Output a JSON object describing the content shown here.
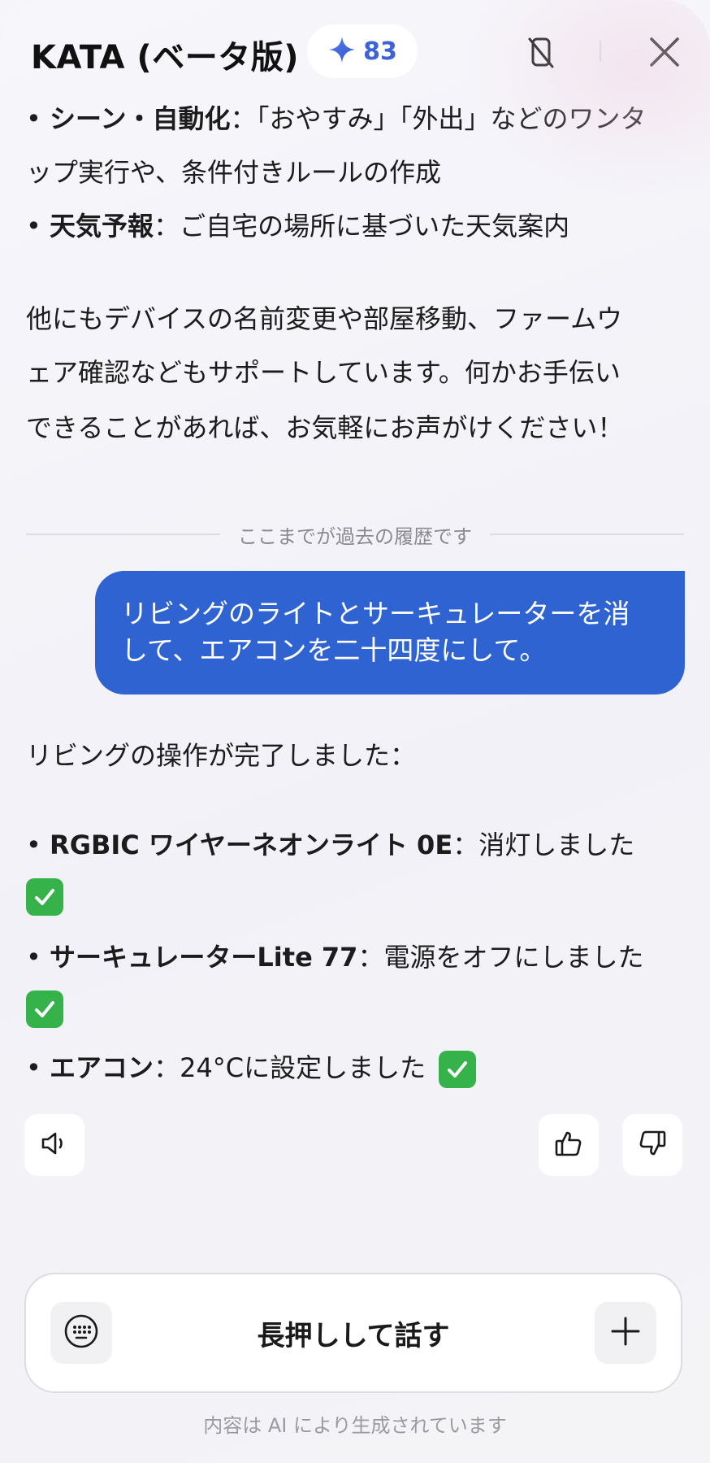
{
  "header": {
    "title": "KATA (ベータ版)",
    "credits": "83",
    "accent": "#3e63d6"
  },
  "prev_message": {
    "bullet1_title": "シーン・自動化",
    "bullet1_text_a": "「おやすみ」「外出」などのワンタ",
    "bullet1_text_b": "ップ実行や、条件付きルールの作成",
    "bullet2_title": "天気予報",
    "bullet2_text": "ご自宅の場所に基づいた天気案内",
    "para_line1": "他にもデバイスの名前変更や部屋移動、ファームウ",
    "para_line2": "ェア確認などもサポートしています。何かお手伝い",
    "para_line3": "できることがあれば、お気軽にお声がけください！"
  },
  "history_separator": "ここまでが過去の履歴です",
  "user_message": {
    "line1": "リビングのライトとサーキュレーターを消",
    "line2": "して、エアコンを二十四度にして。",
    "bubble_color": "#2f63d1"
  },
  "assistant_reply": {
    "intro": "リビングの操作が完了しました：",
    "items": [
      {
        "device": "RGBIC ワイヤーネオンライト 0E",
        "status": "消灯しました"
      },
      {
        "device": "サーキュレーターLite 77",
        "status": "電源をオフにしました"
      },
      {
        "device": "エアコン",
        "status": "24°Cに設定しました"
      }
    ],
    "check_color": "#36b24a"
  },
  "actions": {
    "speaker": "speaker-icon",
    "like": "thumbs-up-icon",
    "dislike": "thumbs-down-icon"
  },
  "composer": {
    "hold_to_talk": "長押しして話す"
  },
  "footer_note": "内容は AI により生成されています"
}
